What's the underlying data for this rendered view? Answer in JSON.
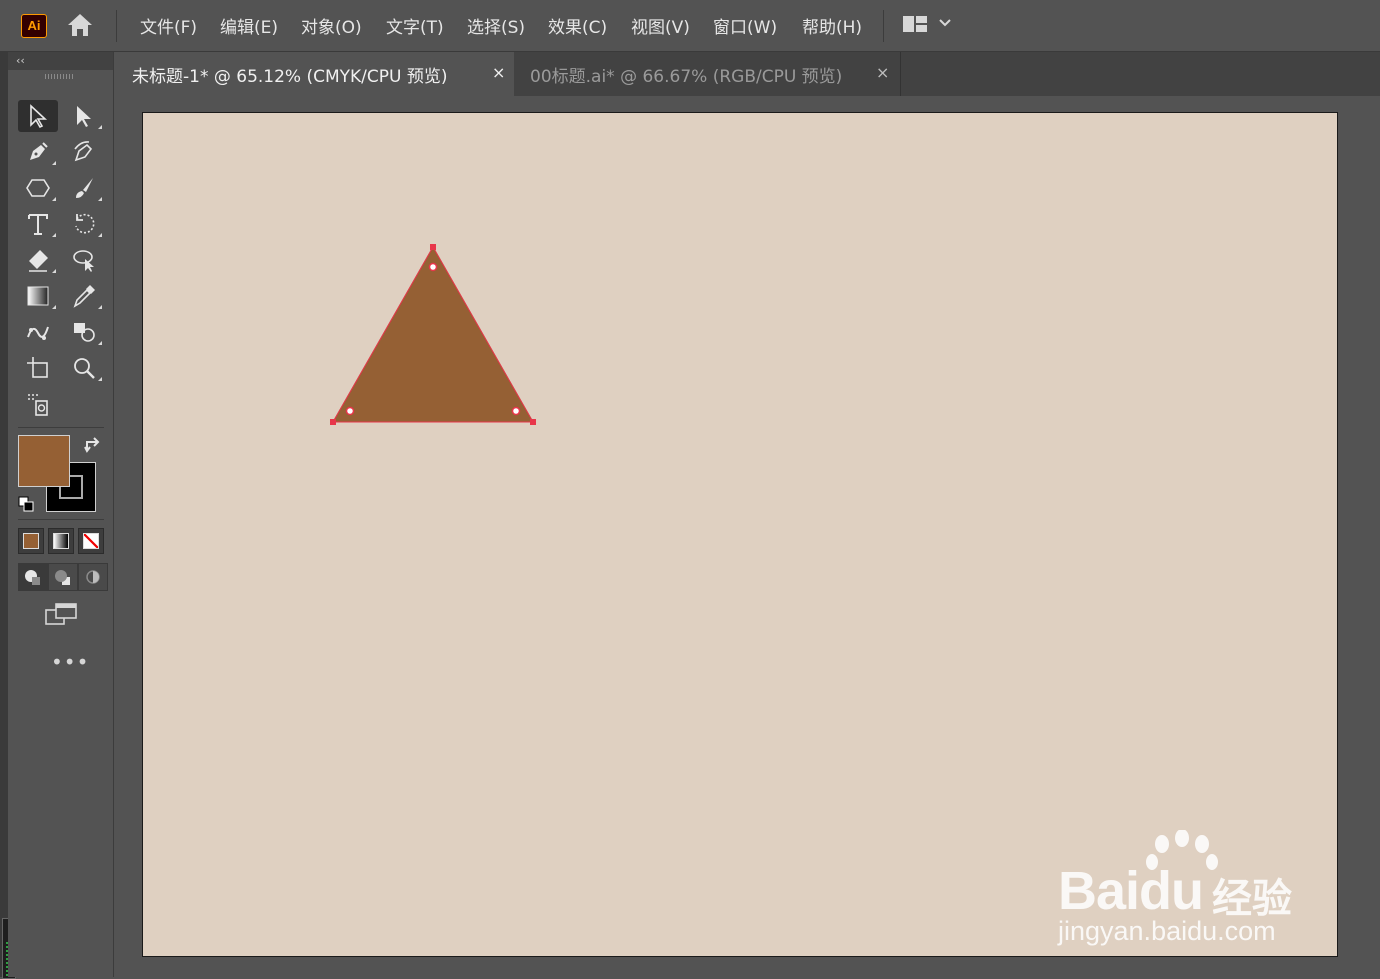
{
  "app": {
    "logo_text": "Ai"
  },
  "menu": {
    "items": [
      "文件(F)",
      "编辑(E)",
      "对象(O)",
      "文字(T)",
      "选择(S)",
      "效果(C)",
      "视图(V)",
      "窗口(W)",
      "帮助(H)"
    ]
  },
  "tabs": [
    {
      "label": "未标题-1* @ 65.12% (CMYK/CPU 预览)",
      "close": "×",
      "active": true
    },
    {
      "label": "00标题.ai* @ 66.67% (RGB/CPU 预览)",
      "close": "×",
      "active": false
    }
  ],
  "toolbar": {
    "collapse_glyph": "‹‹",
    "more_glyph": "•••",
    "fill_color": "#956034",
    "stroke_color": "#000000",
    "tools": [
      "selection-tool",
      "direct-selection-tool",
      "pen-tool",
      "curvature-tool",
      "shape-tool",
      "paintbrush-tool",
      "type-tool",
      "rotate-tool",
      "eraser-tool",
      "lasso-select-tool",
      "gradient-tool",
      "eyedropper-tool",
      "blend-tool",
      "shape-builder-tool",
      "artboard-tool",
      "zoom-tool",
      "symbol-sprayer-tool"
    ]
  },
  "document": {
    "artboard_color": "#dfd0c1",
    "shape": {
      "type": "triangle",
      "fill": "#956034",
      "selection_color": "#e8364a"
    }
  },
  "watermark": {
    "brand": "Bai",
    "brand_suffix": "du",
    "product": "经验",
    "url": "jingyan.baidu.com"
  }
}
